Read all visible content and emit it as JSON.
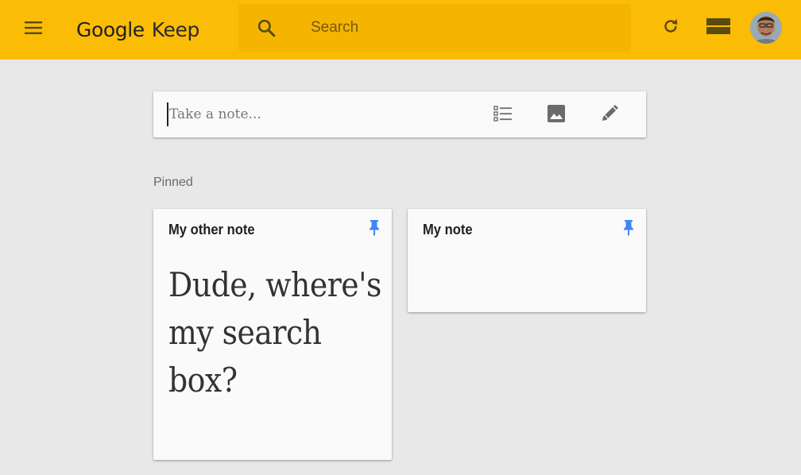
{
  "app": {
    "logo_google": "Google",
    "logo_keep": "Keep",
    "brand_color": "#fbbc05"
  },
  "header": {
    "menu_icon": "hamburger-menu-icon",
    "search_placeholder": "Search",
    "search_icon": "magnifier-icon",
    "refresh_icon": "refresh-icon",
    "view_icon": "list-view-icon",
    "avatar": "user-avatar"
  },
  "take_note": {
    "placeholder": "Take a note...",
    "tools": [
      "list-icon",
      "image-icon",
      "pen-icon"
    ]
  },
  "pinned": {
    "label": "Pinned",
    "pin_color": "#4285f4",
    "notes": [
      {
        "title": "My other note",
        "body": "Dude, where's my search box?"
      },
      {
        "title": "My note",
        "body": ""
      }
    ]
  }
}
